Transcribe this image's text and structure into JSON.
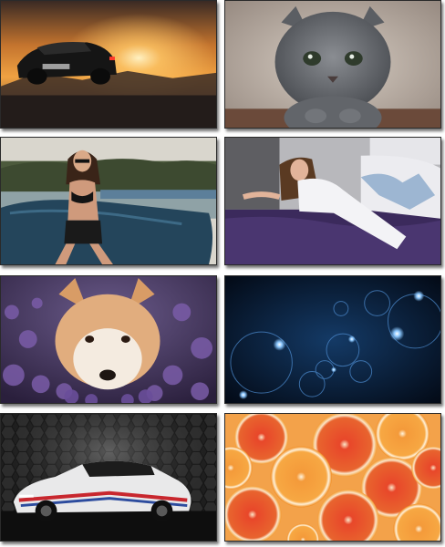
{
  "tiles": [
    {
      "id": "tile-1",
      "subject": "supercar-sunset",
      "colors": {
        "sky": "#e08a2e",
        "sun": "#ffd27a",
        "car": "#1a1a1a"
      }
    },
    {
      "id": "tile-2",
      "subject": "grey-kitten",
      "colors": {
        "fur": "#6e7176",
        "bg": "#b9aea6",
        "eyes": "#2e3a2a"
      }
    },
    {
      "id": "tile-3",
      "subject": "woman-on-car",
      "colors": {
        "sky": "#d8d3c8",
        "car": "#2b4d63",
        "trees": "#4d5a3a"
      }
    },
    {
      "id": "tile-4",
      "subject": "woman-on-bed",
      "colors": {
        "blanket": "#3a2a5a",
        "sheet": "#e8e8ec",
        "jeans": "#9fb7d0"
      }
    },
    {
      "id": "tile-5",
      "subject": "akita-dog-lavender",
      "colors": {
        "lavender": "#5d4a8c",
        "fur": "#e0b48a",
        "bg": "#3a2a4e"
      }
    },
    {
      "id": "tile-6",
      "subject": "blue-bokeh-circles",
      "colors": {
        "bg": "#061426",
        "glow": "#6ab4ff"
      }
    },
    {
      "id": "tile-7",
      "subject": "race-car-dark",
      "colors": {
        "bg": "#1d1d1d",
        "car": "#e9e9ea",
        "stripe_red": "#c8272e",
        "stripe_blue": "#2d4c9e"
      }
    },
    {
      "id": "tile-8",
      "subject": "blood-orange-slices",
      "colors": {
        "flesh": "#e85a2b",
        "rind": "#f7a23c",
        "pith": "#fbe6c8"
      }
    }
  ]
}
